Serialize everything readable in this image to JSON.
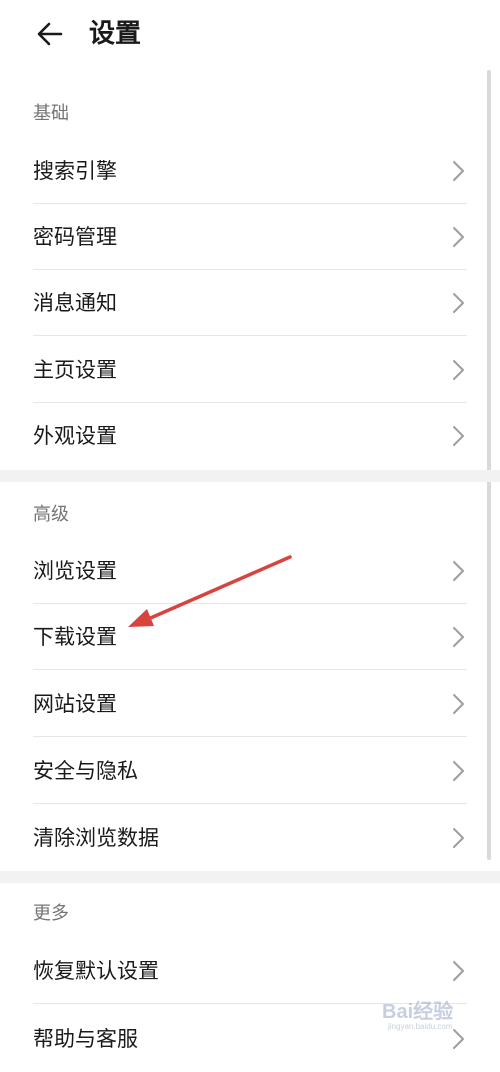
{
  "header": {
    "title": "设置"
  },
  "sections": [
    {
      "title": "基础",
      "items": [
        "搜索引擎",
        "密码管理",
        "消息通知",
        "主页设置",
        "外观设置"
      ]
    },
    {
      "title": "高级",
      "items": [
        "浏览设置",
        "下载设置",
        "网站设置",
        "安全与隐私",
        "清除浏览数据"
      ]
    },
    {
      "title": "更多",
      "items": [
        "恢复默认设置",
        "帮助与客服"
      ]
    }
  ],
  "watermark": {
    "text": "Bai经验",
    "subtext": "jingyan.baidu.com"
  },
  "colors": {
    "arrow": "#d9433f",
    "separator": "#f2f2f2",
    "section_title": "#757575"
  },
  "icons": {
    "back": "arrow-left-icon",
    "chevron": "chevron-right-icon"
  }
}
